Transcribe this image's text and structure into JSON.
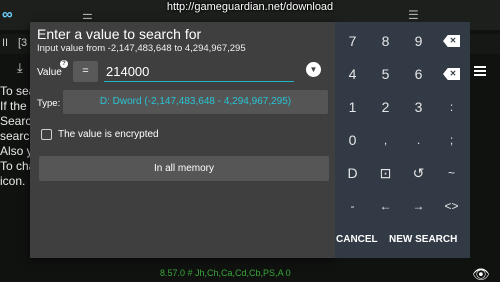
{
  "banner": {
    "url": "http://gameguardian.net/download"
  },
  "background": {
    "tab_pause": "II",
    "tab_bracket": "[3",
    "lines": "To sea\nIf the\nSearch\nsearch\nAlso y\nTo cha\nicon.",
    "status": "8.57.0 # Jh,Ch,Ca,Cd,Cb,PS,A 0"
  },
  "dialog": {
    "title": "Enter a value to search for",
    "subtitle": "Input value from -2,147,483,648 to 4,294,967,295",
    "value_label": "Value",
    "info_badge": "?",
    "operator": "=",
    "value": "214000",
    "type_label": "Type:",
    "type_value": "D: Dword (-2,147,483,648 - 4,294,967,295)",
    "encrypted_label": "The value is encrypted",
    "encrypted_checked": false,
    "memory_button": "In all memory"
  },
  "keypad": {
    "rows": [
      [
        "7",
        "8",
        "9",
        "backspace"
      ],
      [
        "4",
        "5",
        "6",
        "clear"
      ],
      [
        "1",
        "2",
        "3",
        ":"
      ],
      [
        "0",
        ",",
        ".",
        ";"
      ],
      [
        "D",
        "select-icon",
        "history-icon",
        "~"
      ],
      [
        "-",
        "←",
        "→",
        "<>"
      ]
    ]
  },
  "actions": {
    "cancel": "CANCEL",
    "new_search": "NEW SEARCH"
  },
  "icons": {
    "history": "chevron-down-icon",
    "eye": "eye-icon",
    "menu": "menu-icon"
  },
  "colors": {
    "accent": "#1fb5c4",
    "type_text": "#29c4d4",
    "dialog_bg": "#3f3f3f",
    "keypad_bg": "#323a45"
  }
}
